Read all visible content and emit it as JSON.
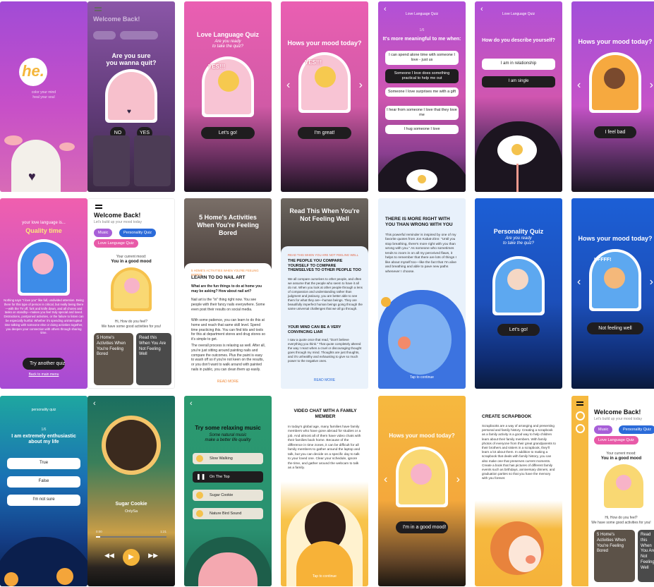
{
  "s1": {
    "tagline1": "color your mind",
    "tagline2": "heal your soul"
  },
  "s2": {
    "title": "Welcome Back!",
    "question1": "Are you sure",
    "question2": "you wanna quit?",
    "no": "NO",
    "yes": "YES"
  },
  "s3": {
    "title": "Love Language Quiz",
    "sub1": "Are you ready",
    "sub2": "to take the quiz?",
    "badge": "YES!!!",
    "button": "Let's go!"
  },
  "s4": {
    "title": "Hows your mood today?",
    "badge": "YES!!!",
    "button": "I'm great!"
  },
  "s5": {
    "header": "Love Language Quiz",
    "progress": "1/6",
    "question": "It's more meaningful to me when:",
    "options": [
      "I can spend alone time with someone I love - just us",
      "Someone I love does something practical to help me out",
      "Someone I love surprises me with a gift",
      "I hear from someone I love that they love me",
      "I hug someone I love"
    ],
    "selected": 1
  },
  "s6": {
    "header": "Love Language Quiz",
    "question": "How do you describe yourself?",
    "options": [
      "I am in relationship",
      "I am single"
    ]
  },
  "s7": {
    "title": "Hows your mood today?",
    "button": "I feel bad"
  },
  "s8": {
    "line1": "your love language is...",
    "title": "Quality time",
    "body": "Nothing says \"I love you\" like full, undivided attention. Being there for this type of person is critical, but really being there—with the TV off, fork and knife down, and all chores and tasks on standby—makes you feel truly special and loved. Distractions, postponed activities, or the failure to listen can be especially hurtful. Whether it's spending uninterrupted time talking with someone else or doing activities together, you deepen your connection with others through sharing time.",
    "button": "Try another quiz",
    "link": "Back to main menu"
  },
  "s9": {
    "title": "Welcome Back!",
    "sub": "Let's build up your mood today",
    "pills": [
      "Music",
      "Personality Quiz",
      "Love Language Quiz"
    ],
    "mood_label": "Your current mood:",
    "mood": "You in a good mood",
    "greet1": "Hi, How do you feel?",
    "greet2": "We have some good activities for you!",
    "cards": [
      "5 Home's Activities When You're Feeling Bored",
      "Read this When You Are Not Feeling Well"
    ]
  },
  "s10": {
    "hero": "5 Home's Activities When You're Feeling Bored",
    "kicker": "5 HOME'S ACTIVITIES WHEN YOU'RE FEELING BORED",
    "h1": "LEARN TO DO NAIL ART",
    "q": "What are the fun things to do at home you may be asking? How about nail art?",
    "p1": "Nail art is the \"in\" thing right now. You see people with their fancy nails everywhere. Some even post their results on social media.",
    "p2": "With some patience, you can learn to do this at home and reach that same skill level. Spend time practicing this. You can find kits and tools for this at department stores and drug stores so it's simple to get.",
    "p3": "The overall process is relaxing as well. After all, you're just sitting around painting nails and compare the outcomes. Plus the paint is easy to wash off so if you're not keen on the results, or you don't want to walk around with painted nails in public, you can clean them up easily.",
    "more": "READ MORE"
  },
  "s11": {
    "hero": "Read This When You're Not Feeling Well",
    "kicker": "READ THIS WHEN YOU ARE NOT FEELING WELL",
    "h1": "THE PEOPLE YOU COMPARE YOURSELF TO COMPARE THEMSELVES TO OTHER PEOPLE TOO",
    "p1": "We all compare ourselves to other people, and often we assume that the people who seem to have it all do not. When you look at other people through a lens of compassion and understanding rather than judgment and jealousy, you are better able to see them for what they are—human beings. They are beautifully imperfect human beings going through the same universal challenges that we all go through.",
    "h2": "YOUR MIND CAN BE A VERY CONVINCING LIAR",
    "p2": "I saw a quote once that read, \"Don't believe everything you think.\" That quote completely altered the way I react when a cruel or discouraging thought goes through my mind. Thoughts are just thoughts, and it's unhealthy and exhausting to give so much power to the negative ones.",
    "more": "READ MORE"
  },
  "s12": {
    "title": "THERE IS MORE RIGHT WITH YOU THAN WRONG WITH YOU",
    "body": "This powerful reminder is inspired by one of my favorite quotes from Jon Kabat-Zinn: \"Until you stop breathing, there's more right with you than wrong with you.\" As someone who sometimes tends to zoom in on all my perceived flaws, it helps to remember that there are lots of things I like about myself too—like the fact that I'm alive and breathing and able to pave new paths whenever I choose.",
    "tap": "Tap to continue"
  },
  "s13": {
    "title": "Personality Quiz",
    "sub1": "Are you ready",
    "sub2": "to take the quiz?",
    "button": "Let's go!"
  },
  "s14": {
    "title": "Hows your mood today?",
    "badge": "UFFFF!",
    "button": "Not feeling well"
  },
  "s15": {
    "header": "personality quiz",
    "progress": "1/6",
    "question": "I am extremely enthusiastic about my life",
    "options": [
      "True",
      "False",
      "I'm not sure"
    ]
  },
  "s16": {
    "track": "Sugar Cookie",
    "artist": "OnlySa",
    "t0": "0:00",
    "t1": "1:21"
  },
  "s17": {
    "title": "Try some relaxing music",
    "sub1": "Some natural music",
    "sub2": "make a better life quality",
    "tracks": [
      "Slow Walking",
      "On The Top",
      "Sugar Cookie",
      "Nature Bird Sound"
    ],
    "playing": 1
  },
  "s18": {
    "title": "VIDEO CHAT WITH A FAMILY MEMBER",
    "body": "In today's global age, many families have family members who have gone abroad for studies or a job. And almost all of them have video chats with their families back home. Because of the difference in time zones, it can be difficult for all family members to gather around the laptop and talk, but you can decide on a specific day to talk to your loved one. Clear your schedule, ignore the time, and gather around the webcam to talk as a family.",
    "tap": "Tap to continue"
  },
  "s19": {
    "title": "Hows your mood today?",
    "button": "I'm in a good mood!"
  },
  "s20": {
    "title": "CREATE SCRAPBOOK",
    "body": "Scrapbooks are a way of arranging and presenting personal and family history. Creating a scrapbook as a family activity is a good way to help children learn about their family members. With family photos of everyone from their great grandparents to their brothers and sisters in a scrapbook, they'll learn a lot about them. In addition to making a scrapbook that deals with family history, you can also make one that preserves current moments. Create a book that has pictures of different family events such as birthdays, anniversary dinners, and graduation parties so that you have the memory with you forever."
  },
  "s21": {
    "title": "Welcome Back!",
    "sub": "Let's build up your mood today",
    "pills": [
      "Music",
      "Personality Quiz",
      "Love Language Quiz"
    ],
    "mood_label": "Your current mood:",
    "mood": "You in a good mood",
    "greet1": "Hi, How do you feel?",
    "greet2": "We have some good activities for you!",
    "cards": [
      "5 Home's Activities When You're Feeling Bored",
      "Read this When You Are Not Feeling Well"
    ]
  }
}
